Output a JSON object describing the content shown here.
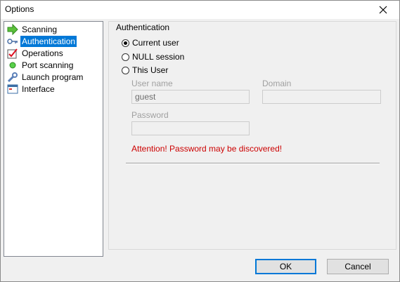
{
  "window": {
    "title": "Options"
  },
  "tree": {
    "items": [
      {
        "label": "Scanning",
        "icon": "green-arrow-icon"
      },
      {
        "label": "Authentication",
        "icon": "key-icon",
        "selected": true
      },
      {
        "label": "Operations",
        "icon": "checklist-icon"
      },
      {
        "label": "Port scanning",
        "icon": "green-dot-icon"
      },
      {
        "label": "Launch program",
        "icon": "wrench-icon"
      },
      {
        "label": "Interface",
        "icon": "window-icon"
      }
    ]
  },
  "auth": {
    "group_title": "Authentication",
    "options": {
      "current_user": "Current user",
      "null_session": "NULL session",
      "this_user": "This User"
    },
    "selected": "current_user",
    "user_name_label": "User name",
    "user_name_value": "guest",
    "domain_label": "Domain",
    "domain_value": "",
    "password_label": "Password",
    "password_value": "",
    "warning": "Attention! Password may be discovered!"
  },
  "buttons": {
    "ok": "OK",
    "cancel": "Cancel"
  },
  "colors": {
    "selection": "#0078d7",
    "warning": "#cc0000"
  }
}
